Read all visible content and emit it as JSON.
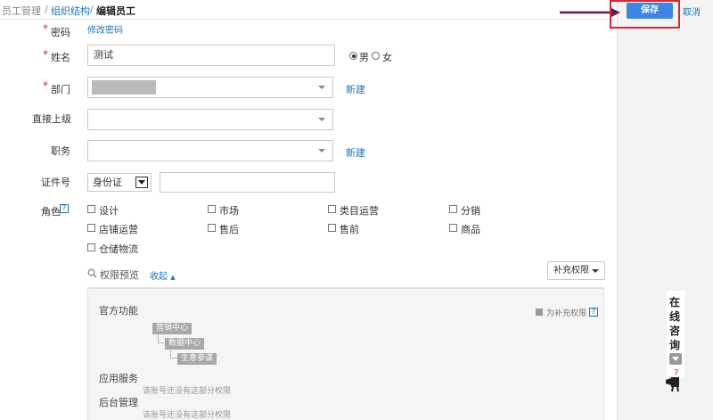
{
  "breadcrumb": {
    "item1": "员工管理",
    "sep": "/",
    "item2": "组织结构",
    "current": "编辑员工"
  },
  "actions": {
    "save": "保存",
    "cancel": "取消"
  },
  "form": {
    "password": {
      "label": "密码",
      "link": "修改密码"
    },
    "name": {
      "label": "姓名",
      "value": "测试"
    },
    "gender": {
      "male": "男",
      "female": "女",
      "selected": "male"
    },
    "department": {
      "label": "部门",
      "new_link": "新建"
    },
    "supervisor": {
      "label": "直接上级"
    },
    "position": {
      "label": "职务",
      "new_link": "新建"
    },
    "id_doc": {
      "label": "证件号",
      "type": "身份证",
      "value": ""
    },
    "roles": {
      "label": "角色",
      "items": [
        "设计",
        "市场",
        "类目运营",
        "分销",
        "店铺运营",
        "售后",
        "售前",
        "商品",
        "仓储物流"
      ]
    }
  },
  "permissions": {
    "preview_label": "权限预览",
    "collapse_label": "收起",
    "supplement_button": "补充权限",
    "legend": "为补充权限",
    "official": {
      "title": "官方功能",
      "tree": [
        "营销中心",
        "数据中心",
        "生意参谋"
      ]
    },
    "app_services": {
      "title": "应用服务",
      "note": "该账号还没有这部分权限"
    },
    "backend": {
      "title": "后台管理",
      "note": "该账号还没有这部分权限"
    }
  },
  "consult": {
    "chars": [
      "在",
      "线",
      "咨",
      "询"
    ]
  },
  "colors": {
    "accent": "#3d85e6",
    "link": "#1a75bb",
    "required": "#e0262b",
    "highlight_box": "#e0262b",
    "arrow": "#6b1e4a"
  },
  "icons": {
    "search": "search-icon",
    "help": "help-icon",
    "dropdown": "chevron-down-icon",
    "arrow": "arrow-right-icon",
    "consult": "chat-icon"
  }
}
